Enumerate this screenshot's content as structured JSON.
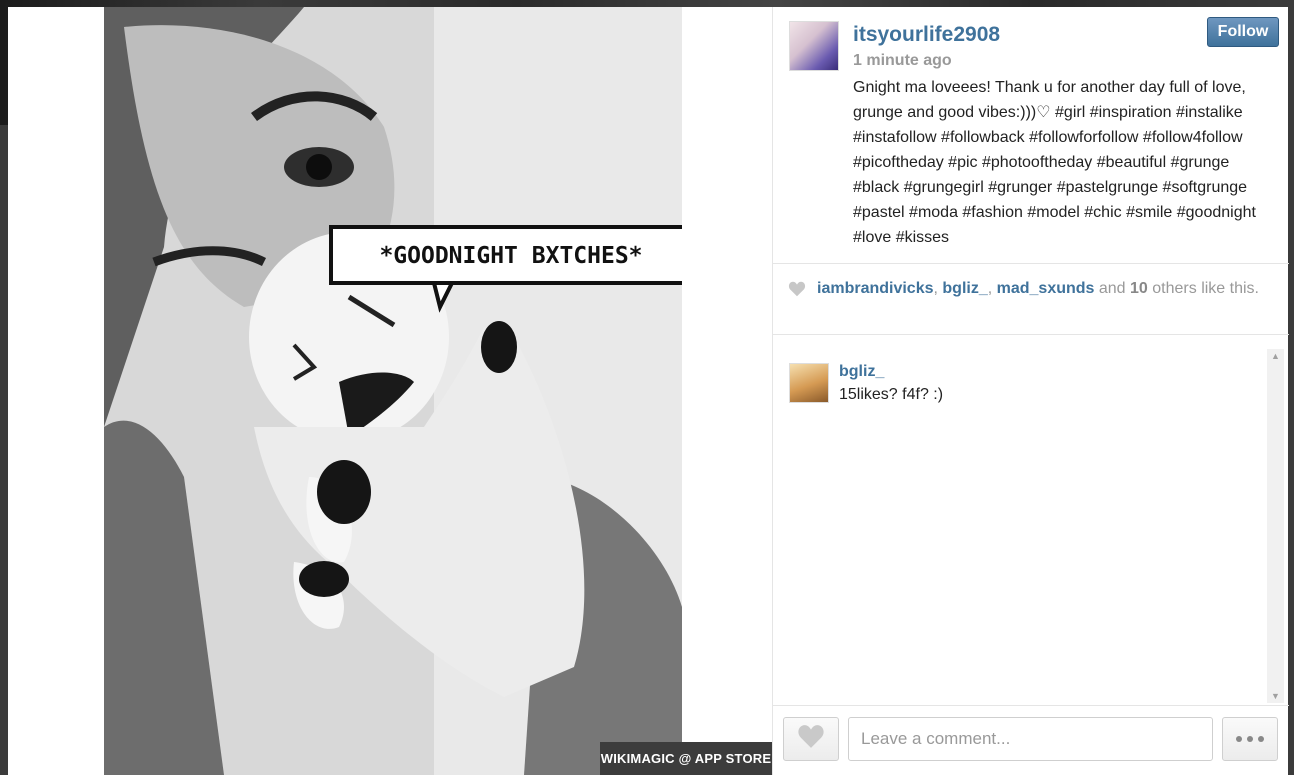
{
  "post": {
    "username": "itsyourlife2908",
    "timestamp": "1 minute ago",
    "follow_label": "Follow",
    "caption": "Gnight ma loveees! Thank u for another day full of love, grunge and good vibes:)))♡ #girl #inspiration #instalike #instafollow #followback #followforfollow #follow4follow #picoftheday #pic #photooftheday #beautiful #grunge #black #grungegirl #grunger #pastelgrunge #softgrunge #pastel #moda #fashion #model #chic #smile #goodnight #love #kisses",
    "speech_bubble": "*GOODNIGHT BXTCHES*",
    "watermark": "WIKIMAGIC @ APP STORE"
  },
  "likes": {
    "users": [
      "iambrandivicks",
      "bgliz_",
      "mad_sxunds"
    ],
    "sep1": ", ",
    "sep2": ", ",
    "and": " and ",
    "count": "10",
    "suffix": " others like this."
  },
  "comments": [
    {
      "user": "bgliz_",
      "text": "15likes? f4f? :)"
    }
  ],
  "footer": {
    "comment_placeholder": "Leave a comment..."
  },
  "icons": {
    "likes_heart": "heart-icon",
    "like_button": "heart-icon",
    "more": "more-dots-icon",
    "scroll_up": "arrow-up-icon",
    "scroll_down": "arrow-down-icon"
  }
}
